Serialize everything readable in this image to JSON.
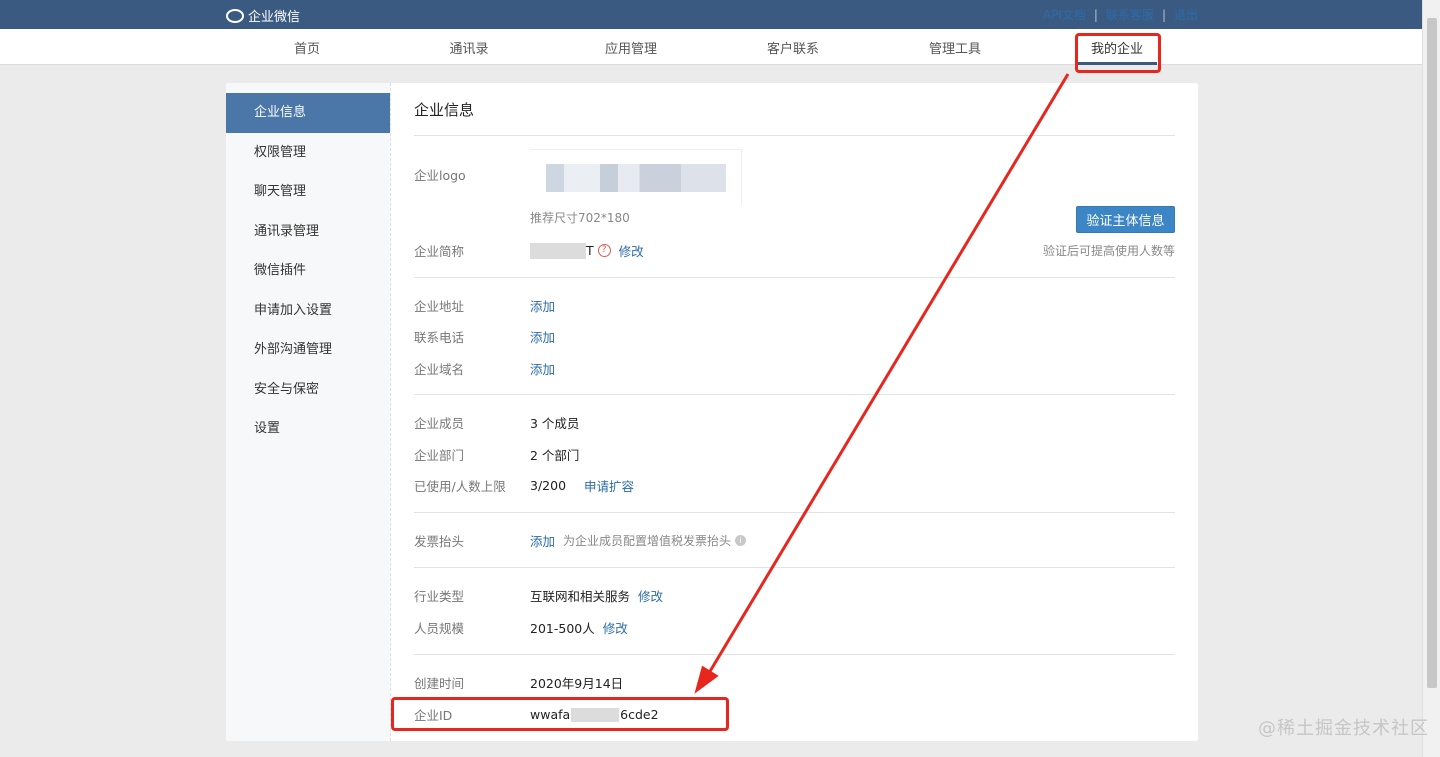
{
  "topbar": {
    "logo_text": "企业微信",
    "links": [
      "API文档",
      "联系客服",
      "退出"
    ]
  },
  "nav": {
    "items": [
      "首页",
      "通讯录",
      "应用管理",
      "客户联系",
      "管理工具",
      "我的企业"
    ],
    "active": "我的企业"
  },
  "sidebar": {
    "items": [
      "企业信息",
      "权限管理",
      "聊天管理",
      "通讯录管理",
      "微信插件",
      "申请加入设置",
      "外部沟通管理",
      "安全与保密",
      "设置"
    ],
    "active": "企业信息"
  },
  "content": {
    "title": "企业信息",
    "logo_label": "企业logo",
    "logo_size_hint": "推荐尺寸702*180",
    "verify_button": "验证主体信息",
    "verify_hint": "验证后可提高使用人数等",
    "short_name_label": "企业简称",
    "short_name_value_tail": "T",
    "edit": "修改",
    "address_label": "企业地址",
    "phone_label": "联系电话",
    "domain_label": "企业域名",
    "add": "添加",
    "members_label": "企业成员",
    "members_value": "3 个成员",
    "departments_label": "企业部门",
    "departments_value": "2 个部门",
    "limit_label": "已使用/人数上限",
    "limit_value": "3/200",
    "expand_link": "申请扩容",
    "invoice_label": "发票抬头",
    "invoice_hint": "为企业成员配置增值税发票抬头",
    "industry_label": "行业类型",
    "industry_value": "互联网和相关服务",
    "scale_label": "人员规模",
    "scale_value": "201-500人",
    "created_label": "创建时间",
    "created_value": "2020年9月14日",
    "id_label": "企业ID",
    "id_prefix": "wwafa",
    "id_suffix": "6cde2"
  },
  "watermark": "@稀土掘金技术社区",
  "colors": {
    "topbar": "#3a5a82",
    "accent": "#4a76a8",
    "link": "#2c6ca8",
    "annotation": "#e7271d"
  }
}
